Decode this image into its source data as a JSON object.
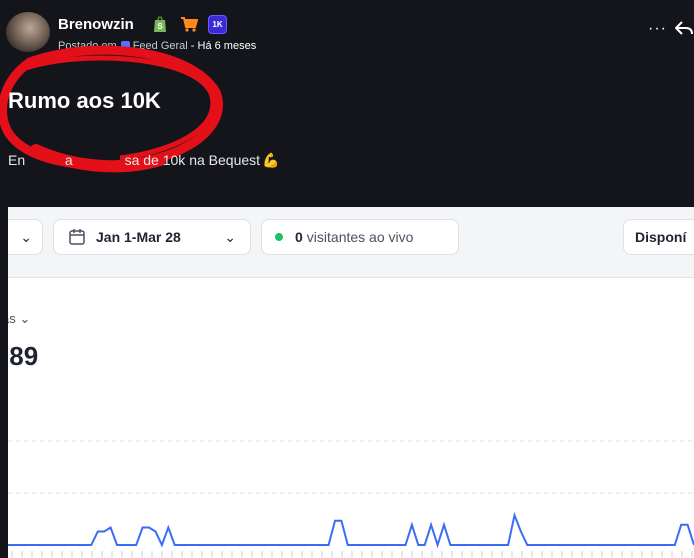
{
  "post": {
    "author": "Brenowzin",
    "badges": [
      "shopify-icon",
      "cart-icon",
      "1k-badge"
    ],
    "badge_1k_label": "1K",
    "meta_prefix": "Postado em",
    "feed_name": "Feed Geral",
    "time_label": "- Há 6 meses",
    "more_label": "···",
    "title": "Rumo aos 10K",
    "body_start": "En",
    "body_mid": "a",
    "body_end": "sa de 10k na Bequest",
    "body_emoji": "💪",
    "highlight_color": "#e3101a"
  },
  "embed": {
    "filter_chevron": "⌄",
    "date_range": "Jan 1-Mar 28",
    "date_chevron": "⌄",
    "live_count": "0",
    "live_label": "visitantes ao vivo",
    "availability_label": "Disponí",
    "metric_label": "as",
    "metric_chevron": "⌄",
    "metric_value": "89",
    "metric_value_prefix": ".",
    "line_color": "#3b6cf6",
    "live_dot_color": "#1fbf6b"
  },
  "chart_data": {
    "type": "line",
    "series": [
      {
        "values": [
          0,
          0,
          0,
          0,
          0,
          0,
          0,
          0,
          0,
          0,
          0,
          0,
          0,
          0,
          1,
          1,
          1.3,
          0,
          0,
          0,
          0,
          1.3,
          1.3,
          1,
          0,
          1.3,
          0,
          0,
          0,
          0,
          0,
          0,
          0,
          0,
          0,
          0,
          0,
          0,
          0,
          0,
          0,
          0,
          0,
          0,
          0,
          0,
          0,
          0,
          0,
          0,
          0,
          1.8,
          1.8,
          0,
          0,
          0,
          0,
          0,
          0,
          0,
          0,
          0,
          0,
          1.5,
          0,
          0,
          1.5,
          0,
          1.5,
          0,
          0,
          0,
          0,
          0,
          0,
          0,
          0,
          0,
          0,
          2.2,
          1,
          0,
          0,
          0,
          0,
          0,
          0,
          0,
          0,
          0,
          0,
          0,
          0,
          0,
          0,
          0,
          0,
          0,
          0,
          0,
          0,
          0,
          0,
          0,
          0,
          1.5,
          1.5,
          0
        ]
      }
    ],
    "grid": true
  }
}
